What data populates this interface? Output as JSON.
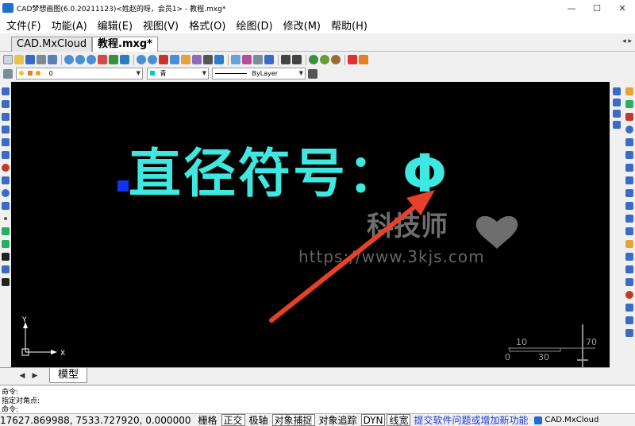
{
  "window": {
    "title": "CAD梦想画图(6.0.20211123)<姓赵的呀，会员1> - 教程.mxg*",
    "minimize_glyph": "—",
    "maximize_glyph": "☐",
    "close_glyph": "✕"
  },
  "menu": {
    "items": [
      {
        "label": "文件(F)"
      },
      {
        "label": "功能(A)"
      },
      {
        "label": "编辑(E)"
      },
      {
        "label": "视图(V)"
      },
      {
        "label": "格式(O)"
      },
      {
        "label": "绘图(D)"
      },
      {
        "label": "修改(M)"
      },
      {
        "label": "帮助(H)"
      }
    ]
  },
  "doc_tabs": [
    {
      "label": "CAD.MxCloud"
    },
    {
      "label": "教程.mxg*",
      "active": true
    }
  ],
  "tab_arrows": "◂ ▸",
  "properties": {
    "layer": "0",
    "color": "青",
    "color_swatch": "#00c8c8",
    "linetype": "ByLayer"
  },
  "canvas": {
    "drawing_text": "直径符号：Φ",
    "background": "#000000",
    "text_color": "#3ee8e0",
    "arrow_color": "#e8412a",
    "watermark_logo": "科技师",
    "watermark_url": "https://www.3kjs.com",
    "ucs": {
      "y_label": "Y",
      "x_label": "X"
    },
    "scale": {
      "label_10": "10",
      "label_70": "70",
      "label_0": "0",
      "label_30": "30"
    }
  },
  "layout_tabs": {
    "model_label": "模型",
    "nav_prev": "◀",
    "nav_next": "▶"
  },
  "command": {
    "line1": "命令:",
    "line2": "  指定对角点:",
    "line3": "命令:"
  },
  "status": {
    "coords": "17627.869988, 7533.727920, 0.000000",
    "buttons": [
      {
        "label": "栅格",
        "on": false
      },
      {
        "label": "正交",
        "on": true
      },
      {
        "label": "极轴",
        "on": false
      },
      {
        "label": "对象捕捉",
        "on": true
      },
      {
        "label": "对象追踪",
        "on": false
      },
      {
        "label": "DYN",
        "on": true
      },
      {
        "label": "线宽",
        "on": true
      }
    ],
    "feedback_link": "提交软件问题或增加新功能",
    "brand": "CAD.MxCloud"
  }
}
